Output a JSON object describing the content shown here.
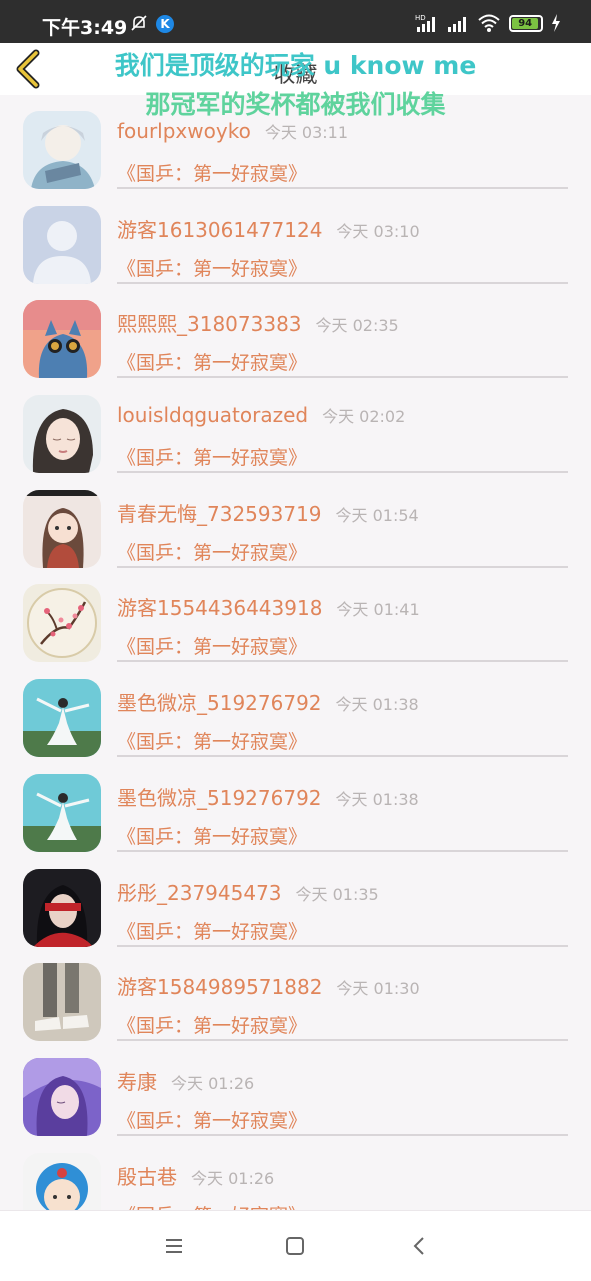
{
  "status_bar": {
    "time": "下午3:49",
    "k_badge": "K",
    "battery": "94",
    "icons": [
      "mute-bell-icon",
      "k-app-icon",
      "hd-signal-icon",
      "signal-icon",
      "wifi-icon",
      "battery-icon",
      "charging-icon"
    ]
  },
  "header": {
    "title": "收藏",
    "back_icon": "chevron-left-icon"
  },
  "overlay_text": {
    "line1": "我们是顶级的玩家 u know me",
    "line2": "那冠军的奖杯都被我们收集"
  },
  "items": [
    {
      "name": "fourlpxwoyko",
      "time": "今天 03:11",
      "message": "《国乒：第一好寂寞》",
      "avatar": "anime-boy-avatar"
    },
    {
      "name": "游客1613061477124",
      "time": "今天 03:10",
      "message": "《国乒：第一好寂寞》",
      "avatar": "default-user-avatar"
    },
    {
      "name": "熙熙熙_318073383",
      "time": "今天 02:35",
      "message": "《国乒：第一好寂寞》",
      "avatar": "blue-cat-avatar"
    },
    {
      "name": "louisldqguatorazed",
      "time": "今天 02:02",
      "message": "《国乒：第一好寂寞》",
      "avatar": "girl-portrait-avatar"
    },
    {
      "name": "青春无悔_732593719",
      "time": "今天 01:54",
      "message": "《国乒：第一好寂寞》",
      "avatar": "cartoon-girl-avatar"
    },
    {
      "name": "游客1554436443918",
      "time": "今天 01:41",
      "message": "《国乒：第一好寂寞》",
      "avatar": "plum-blossom-avatar"
    },
    {
      "name": "墨色微凉_519276792",
      "time": "今天 01:38",
      "message": "《国乒：第一好寂寞》",
      "avatar": "dancer-avatar"
    },
    {
      "name": "墨色微凉_519276792",
      "time": "今天 01:38",
      "message": "《国乒：第一好寂寞》",
      "avatar": "dancer-avatar"
    },
    {
      "name": "彤彤_237945473",
      "time": "今天 01:35",
      "message": "《国乒：第一好寂寞》",
      "avatar": "red-scarf-girl-avatar"
    },
    {
      "name": "游客1584989571882",
      "time": "今天 01:30",
      "message": "《国乒：第一好寂寞》",
      "avatar": "sneakers-avatar"
    },
    {
      "name": "寿康",
      "time": "今天 01:26",
      "message": "《国乒：第一好寂寞》",
      "avatar": "purple-girl-avatar"
    },
    {
      "name": "殷古巷",
      "time": "今天 01:26",
      "message": "《国乒：第一好寂寞》",
      "avatar": "doraemon-kid-avatar"
    }
  ],
  "nav_bar": {
    "icons": [
      "menu-icon",
      "home-square-icon",
      "back-triangle-icon"
    ]
  },
  "colors": {
    "name_text": "#e0855a",
    "time_text": "#b9b4b4",
    "overlay_line1": "#3ec6c8",
    "overlay_line2": "#5fd39d"
  }
}
